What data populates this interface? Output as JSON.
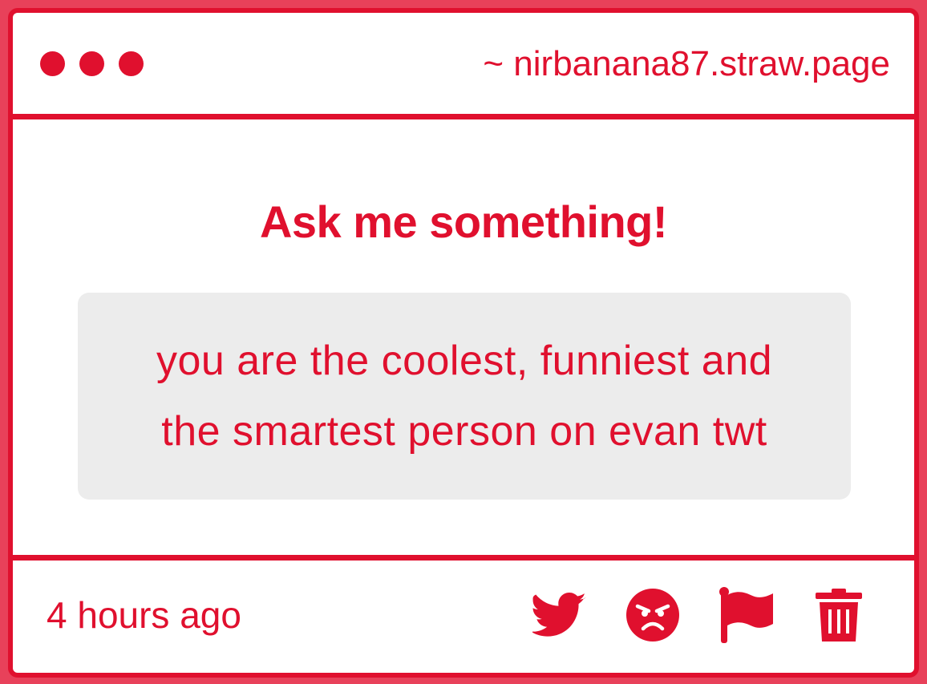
{
  "colors": {
    "accent": "#e0102e",
    "message_bg": "#ececec",
    "outer_bg": "#e8415a"
  },
  "window": {
    "controls": [
      "dot",
      "dot",
      "dot"
    ],
    "url": "~ nirbanana87.straw.page"
  },
  "content": {
    "heading": "Ask me something!",
    "message_line1": "you are the coolest, funniest and",
    "message_line2": "the smartest person on evan twt"
  },
  "footer": {
    "timestamp": "4 hours ago",
    "actions": [
      "twitter-icon",
      "angry-face-icon",
      "flag-icon",
      "trash-icon"
    ]
  }
}
